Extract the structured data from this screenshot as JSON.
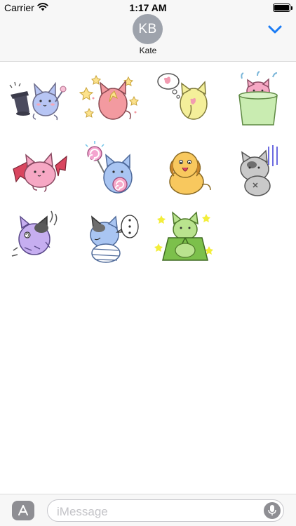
{
  "status_bar": {
    "carrier": "Carrier",
    "time": "1:17 AM",
    "battery_level": 1.0
  },
  "header": {
    "avatar_initials": "KB",
    "contact_name": "Kate",
    "avatar_color": "#9ea3ac",
    "accent_color": "#1b7cf5",
    "icons": [
      "wifi-icon",
      "battery-icon",
      "chevron-down-icon"
    ]
  },
  "stickers": [
    {
      "name": "sticker-cat-magic-hat",
      "description_color": "#b7c5f4"
    },
    {
      "name": "sticker-cat-stars",
      "description_color": "#f39aa0"
    },
    {
      "name": "sticker-cat-heart-thought",
      "description_color": "#f4ef9a"
    },
    {
      "name": "sticker-cat-bucket",
      "description_color": "#f6a8c4"
    },
    {
      "name": "sticker-cat-bat-wings",
      "description_color": "#f6a8c4"
    },
    {
      "name": "sticker-cat-lollipop",
      "description_color": "#a9c5f2"
    },
    {
      "name": "sticker-cat-dog-costume",
      "description_color": "#f8c85e"
    },
    {
      "name": "sticker-cat-gray-scared",
      "description_color": "#c9c9c9"
    },
    {
      "name": "sticker-cat-zombie",
      "description_color": "#c6aef0"
    },
    {
      "name": "sticker-cat-mummy-dots",
      "description_color": "#a9c5f2"
    },
    {
      "name": "sticker-cat-green-cape",
      "description_color": "#b9e38e"
    }
  ],
  "composer": {
    "placeholder": "iMessage",
    "icons": [
      "app-store-icon",
      "microphone-icon"
    ]
  }
}
